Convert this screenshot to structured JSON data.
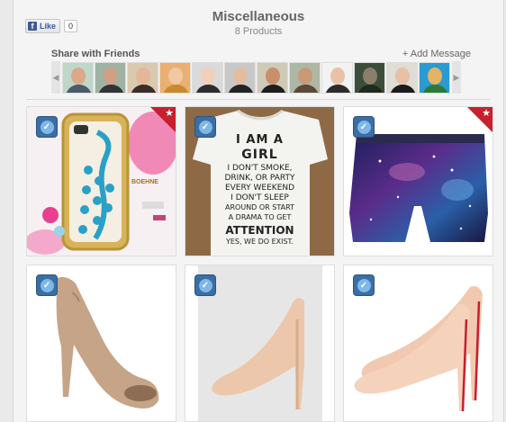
{
  "header": {
    "fb_like_label": "Like",
    "fb_like_count": "0",
    "title": "Miscellaneous",
    "product_count": "8 Products"
  },
  "share": {
    "label": "Share with Friends",
    "add_message": "+ Add Message",
    "prev_icon": "chevron-left-icon",
    "next_icon": "chevron-right-icon",
    "friends_visible": 12
  },
  "tshirt": {
    "line1": "I AM A",
    "line2": "GIRL",
    "line3": "I DON'T SMOKE,",
    "line4": "DRINK, OR PARTY",
    "line5": "EVERY WEEKEND",
    "line6": "I DON'T SLEEP",
    "line7": "AROUND OR START",
    "line8": "A DRAMA TO GET",
    "line9": "ATTENTION",
    "line10": "YES, WE DO EXIST."
  },
  "phone_case": {
    "brand_text": "BOEHNE"
  },
  "colors": {
    "check_blue": "#3a6ea5",
    "ribbon_red": "#c8202c"
  }
}
